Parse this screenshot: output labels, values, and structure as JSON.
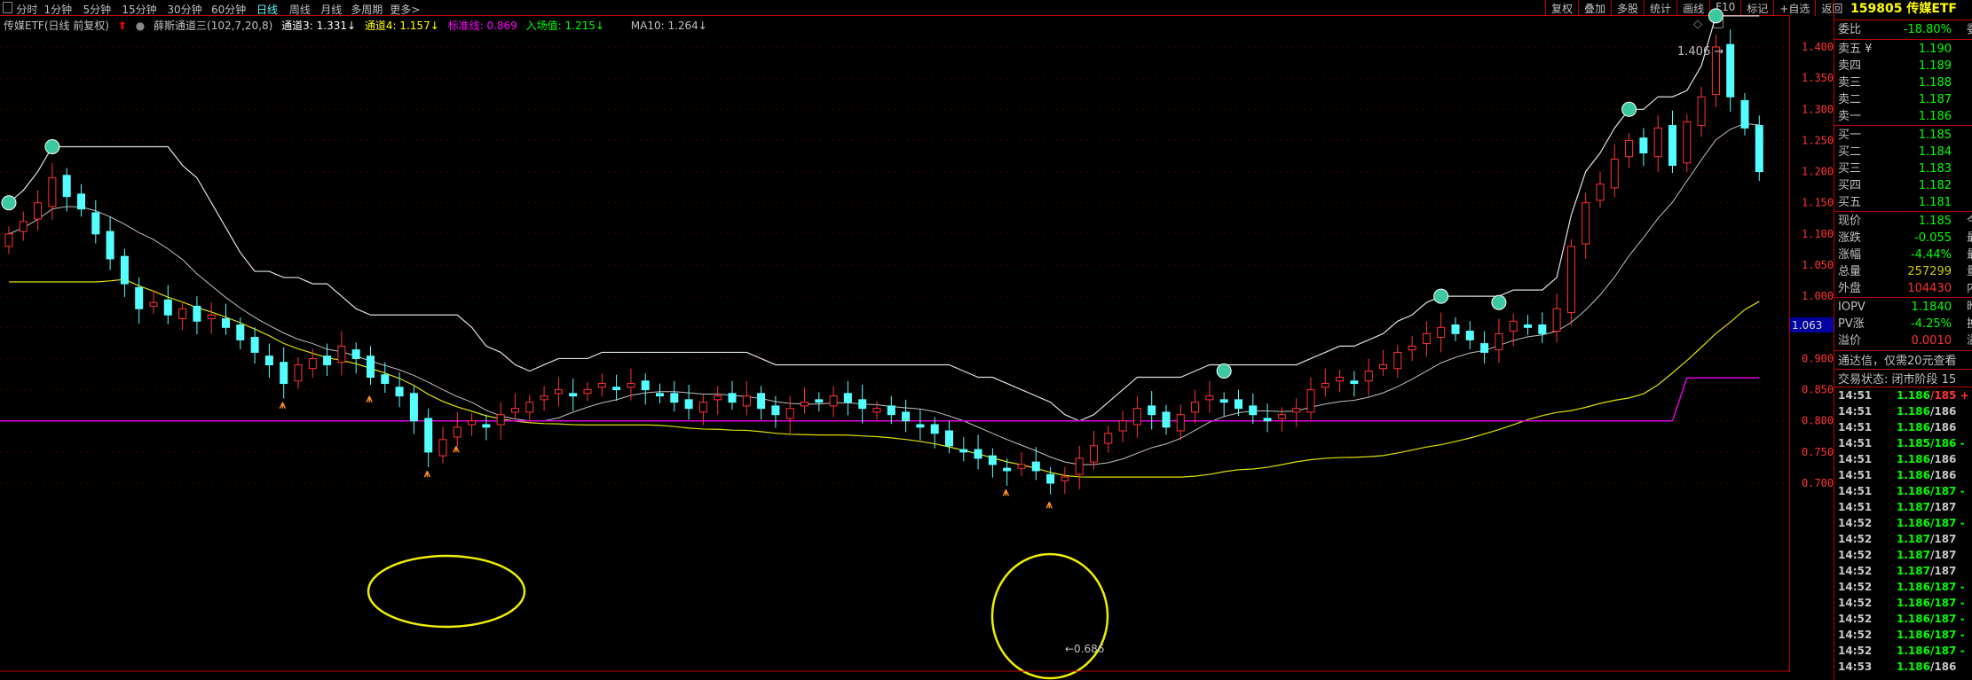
{
  "toolbar": {
    "periods": [
      "分时",
      "1分钟",
      "5分钟",
      "15分钟",
      "30分钟",
      "60分钟",
      "日线",
      "周线",
      "月线",
      "多周期",
      "更多>"
    ],
    "active": "日线",
    "right": [
      "复权",
      "叠加",
      "多股",
      "统计",
      "画线",
      "F10",
      "标记",
      "+自选",
      "返回"
    ]
  },
  "legend": {
    "name": "传媒ETF(日线 前复权)",
    "indicator": "薛斯通道三(102,7,20,8)",
    "ch3": "通道3: 1.331↓",
    "ch4": "通道4: 1.157↓",
    "std": "标准线: 0.869",
    "entry": "入场值: 1.215↓",
    "ma10": "MA10: 1.264↓"
  },
  "panel": {
    "title": "159805 传媒ETF",
    "weibi": {
      "label": "委比",
      "value": "-18.80%",
      "right": "委"
    },
    "sell": [
      {
        "label": "卖五 ¥",
        "value": "1.190"
      },
      {
        "label": "卖四",
        "value": "1.189"
      },
      {
        "label": "卖三",
        "value": "1.188"
      },
      {
        "label": "卖二",
        "value": "1.187"
      },
      {
        "label": "卖一",
        "value": "1.186"
      }
    ],
    "buy": [
      {
        "label": "买一",
        "value": "1.185"
      },
      {
        "label": "买二",
        "value": "1.184"
      },
      {
        "label": "买三",
        "value": "1.183"
      },
      {
        "label": "买四",
        "value": "1.182"
      },
      {
        "label": "买五",
        "value": "1.181"
      }
    ],
    "stats": [
      {
        "label": "现价",
        "value": "1.185",
        "right": "今",
        "c": "g"
      },
      {
        "label": "涨跌",
        "value": "-0.055",
        "right": "最",
        "c": "g"
      },
      {
        "label": "涨幅",
        "value": "-4.44%",
        "right": "最",
        "c": "g"
      },
      {
        "label": "总量",
        "value": "257299",
        "right": "量",
        "c": "y"
      },
      {
        "label": "外盘",
        "value": "104430",
        "right": "内",
        "c": "rd"
      }
    ],
    "iopv": [
      {
        "label": "IOPV",
        "value": "1.1840",
        "right": "昨",
        "c": "g"
      },
      {
        "label": "PV涨",
        "value": "-4.25%",
        "right": "换",
        "c": "g"
      },
      {
        "label": "溢价",
        "value": "0.0010",
        "right": "溢",
        "c": "rd"
      }
    ],
    "promo": "通达信，仅需20元查看",
    "status": "交易状态: 闭市阶段 15",
    "ticks": [
      [
        "14:51",
        "1.186",
        "/185 +",
        "rd"
      ],
      [
        "14:51",
        "1.186",
        "/186",
        "wt"
      ],
      [
        "14:51",
        "1.186",
        "/186",
        "wt"
      ],
      [
        "14:51",
        "1.185",
        "/186 -",
        "g"
      ],
      [
        "14:51",
        "1.186",
        "/186",
        "wt"
      ],
      [
        "14:51",
        "1.186",
        "/186",
        "wt"
      ],
      [
        "14:51",
        "1.186",
        "/187 -",
        "g"
      ],
      [
        "14:51",
        "1.187",
        "/187",
        "wt"
      ],
      [
        "14:52",
        "1.186",
        "/187 -",
        "g"
      ],
      [
        "14:52",
        "1.187",
        "/187",
        "wt"
      ],
      [
        "14:52",
        "1.187",
        "/187",
        "wt"
      ],
      [
        "14:52",
        "1.187",
        "/187",
        "wt"
      ],
      [
        "14:52",
        "1.186",
        "/187 -",
        "g"
      ],
      [
        "14:52",
        "1.186",
        "/187 -",
        "g"
      ],
      [
        "14:52",
        "1.186",
        "/187 -",
        "g"
      ],
      [
        "14:52",
        "1.186",
        "/187 -",
        "g"
      ],
      [
        "14:52",
        "1.186",
        "/187 -",
        "g"
      ],
      [
        "14:53",
        "1.186",
        "/186",
        "wt"
      ]
    ]
  },
  "chart_data": {
    "type": "candlestick",
    "ylim": [
      0.68,
      1.42
    ],
    "yticks": [
      "1.400",
      "1.350",
      "1.300",
      "1.250",
      "1.200",
      "1.150",
      "1.100",
      "1.050",
      "1.000",
      "0.950",
      "0.900",
      "0.850",
      "0.800",
      "0.750",
      "0.700"
    ],
    "cursor_label": "1.063",
    "high_label": "1.406",
    "low_label": "0.686",
    "closes": [
      1.1,
      1.12,
      1.15,
      1.19,
      1.16,
      1.14,
      1.1,
      1.06,
      1.02,
      0.98,
      0.99,
      0.97,
      0.98,
      0.96,
      0.97,
      0.95,
      0.93,
      0.91,
      0.89,
      0.86,
      0.89,
      0.9,
      0.89,
      0.92,
      0.9,
      0.87,
      0.86,
      0.84,
      0.8,
      0.75,
      0.77,
      0.79,
      0.8,
      0.79,
      0.81,
      0.82,
      0.83,
      0.84,
      0.85,
      0.84,
      0.85,
      0.86,
      0.85,
      0.86,
      0.85,
      0.84,
      0.83,
      0.82,
      0.83,
      0.84,
      0.83,
      0.84,
      0.82,
      0.81,
      0.82,
      0.83,
      0.83,
      0.84,
      0.83,
      0.82,
      0.82,
      0.81,
      0.8,
      0.79,
      0.78,
      0.76,
      0.75,
      0.74,
      0.73,
      0.72,
      0.73,
      0.72,
      0.7,
      0.71,
      0.74,
      0.76,
      0.78,
      0.8,
      0.82,
      0.81,
      0.79,
      0.81,
      0.83,
      0.84,
      0.83,
      0.82,
      0.81,
      0.8,
      0.81,
      0.82,
      0.85,
      0.86,
      0.87,
      0.86,
      0.88,
      0.89,
      0.91,
      0.92,
      0.94,
      0.95,
      0.94,
      0.93,
      0.91,
      0.94,
      0.96,
      0.95,
      0.94,
      0.98,
      1.08,
      1.15,
      1.18,
      1.22,
      1.25,
      1.23,
      1.27,
      1.21,
      1.28,
      1.32,
      1.4,
      1.32,
      1.27,
      1.2
    ],
    "standard_line": {
      "base": 0.8,
      "final": 0.869,
      "step_from_index": 116
    },
    "sell_signals": [
      0,
      3,
      99,
      103,
      112,
      118,
      84
    ],
    "buy_signals": [
      19,
      25,
      29,
      31,
      69,
      72
    ]
  },
  "colors": {
    "up": "#ff3232",
    "down": "#54ffff",
    "upper": "#e0e0e0",
    "ma": "#c0c0c0",
    "lower": "#e0e000",
    "std": "#e000e0"
  }
}
